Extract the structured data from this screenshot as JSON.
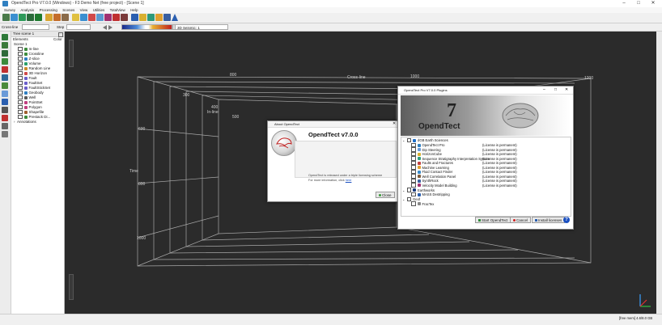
{
  "window": {
    "title": "OpendTect Pro V7.0.0 (Windows) - F3 Demo Net (free project) - [Scene 1]",
    "minimize": "–",
    "maximize": "□",
    "close": "✕"
  },
  "menu": [
    "Survey",
    "Analysis",
    "Processing",
    "Scenes",
    "View",
    "Utilities",
    "TotalView",
    "Help"
  ],
  "toolbar2": {
    "position_label": "Cross-line",
    "step_label": "Step",
    "color_combo": "3D Seismic: 1"
  },
  "tree": {
    "panel_title": "Tree scene 1",
    "col_elements": "Elements",
    "col_color": "Color",
    "items": [
      {
        "label": "Scene 1",
        "color": "#888888"
      },
      {
        "label": "In-line",
        "color": "#3d8b3d"
      },
      {
        "label": "Crossline",
        "color": "#3d8b3d"
      },
      {
        "label": "Z-slice",
        "color": "#2f7fc1"
      },
      {
        "label": "Volume",
        "color": "#2aa06a"
      },
      {
        "label": "Random Line",
        "color": "#c98b2b"
      },
      {
        "label": "3D Horizon",
        "color": "#d04a4a"
      },
      {
        "label": "Fault",
        "color": "#6b5fc9"
      },
      {
        "label": "FaultSet",
        "color": "#6b5fc9"
      },
      {
        "label": "FaultStickSet",
        "color": "#6b5fc9"
      },
      {
        "label": "Geobody",
        "color": "#2f7fc1"
      },
      {
        "label": "Well",
        "color": "#5a5a5a"
      },
      {
        "label": "PointSet",
        "color": "#c04080"
      },
      {
        "label": "Polygon",
        "color": "#c04080"
      },
      {
        "label": "Shapefile",
        "color": "#a06030"
      },
      {
        "label": "Prestack Di...",
        "color": "#3d8b3d"
      },
      {
        "label": "Annotations",
        "color": "#888888"
      }
    ]
  },
  "scene": {
    "label_crossline": "Cross-line",
    "label_inline": "In-line",
    "label_time": "Time",
    "ticks_crossline": [
      "800",
      "1000",
      "1200"
    ],
    "ticks_inline": [
      "300",
      "400",
      "500"
    ],
    "ticks_time": [
      "600",
      "800",
      "1000"
    ]
  },
  "about_dialog": {
    "title": "About OpendTect",
    "heading": "OpendTect v7.0.0",
    "text": "OpendTect is released under a triple licensing scheme",
    "text2": "For more information, click",
    "link": "here",
    "close_button": "Close"
  },
  "plugins_dialog": {
    "title": "OpendTect Pro V7.0.0 Plugins",
    "banner_number": "7",
    "banner_name": "OpendTect",
    "groups": [
      {
        "name": "dGB Earth Sciences",
        "items": [
          {
            "name": "OpendTect Pro",
            "status": "(License is permanent)"
          },
          {
            "name": "Dip Steering",
            "status": "(License is permanent)"
          },
          {
            "name": "HorizonCube",
            "status": "(License is permanent)"
          },
          {
            "name": "Sequence Stratigraphy Interpretation System",
            "status": "(License is permanent)"
          },
          {
            "name": "Faults and Fractures",
            "status": "(License is permanent)"
          },
          {
            "name": "Machine Learning",
            "status": "(License is permanent)"
          },
          {
            "name": "Fluid Contact Finder",
            "status": "(License is permanent)"
          },
          {
            "name": "Well Correlation Panel",
            "status": "(License is permanent)"
          },
          {
            "name": "SynthRock",
            "status": "(License is permanent)"
          },
          {
            "name": "Velocity Model Building",
            "status": "(License is permanent)"
          }
        ]
      },
      {
        "name": "Earthworks",
        "items": [
          {
            "name": "MASS Destripping",
            "status": ""
          }
        ]
      },
      {
        "name": "Geof",
        "items": [
          {
            "name": "FracTex",
            "status": ""
          }
        ]
      }
    ],
    "start_button": "Start OpendTect",
    "cancel_button": "Cancel",
    "install_button": "Install licenses"
  },
  "status": {
    "memory": "[free mem] 4.6/8.0 GB"
  }
}
